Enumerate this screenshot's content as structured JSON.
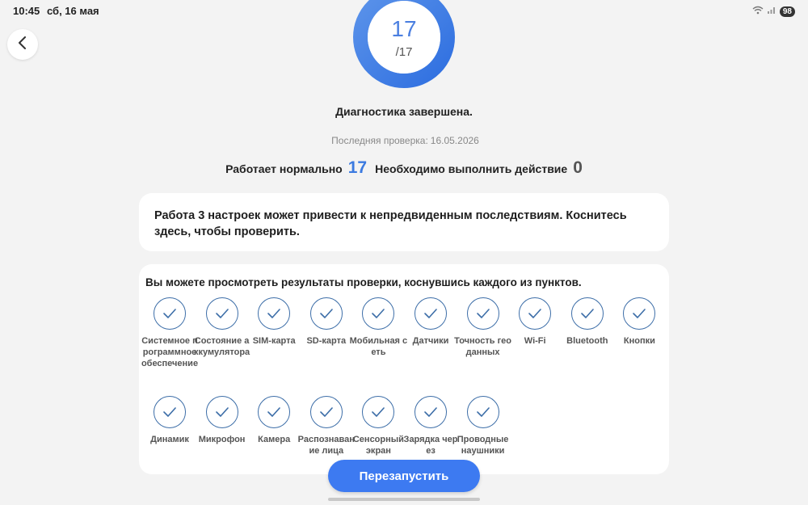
{
  "status": {
    "time": "10:45",
    "date": "сб, 16 мая",
    "battery": "98"
  },
  "score": {
    "value": "17",
    "total": "/17"
  },
  "diagnosis_title": "Диагностика завершена.",
  "last_check": {
    "label": "Последняя проверка:",
    "date": "16.05.2026"
  },
  "counts": {
    "normal_label": "Работает нормально",
    "normal_value": "17",
    "action_label": "Необходимо выполнить действие",
    "action_value": "0"
  },
  "warning_text": "Работа 3 настроек может привести к непредвиденным последствиям. Коснитесь здесь, чтобы проверить.",
  "results": {
    "title": "Вы можете просмотреть результаты проверки, коснувшись каждого из пунктов.",
    "items": [
      {
        "label": "Системное программное обеспечение"
      },
      {
        "label": "Состояние аккумулятора"
      },
      {
        "label": "SIM-карта"
      },
      {
        "label": "SD-карта"
      },
      {
        "label": "Мобильная сеть"
      },
      {
        "label": "Датчики"
      },
      {
        "label": "Точность геоданных"
      },
      {
        "label": "Wi-Fi"
      },
      {
        "label": "Bluetooth"
      },
      {
        "label": "Кнопки"
      },
      {
        "label": "Динамик"
      },
      {
        "label": "Микрофон"
      },
      {
        "label": "Камера"
      },
      {
        "label": "Распознавание лица"
      },
      {
        "label": "Сенсорный экран"
      },
      {
        "label": "Зарядка через"
      },
      {
        "label": "Проводные наушники"
      }
    ]
  },
  "restart_label": "Перезапустить",
  "colors": {
    "accent": "#3d7af1",
    "ring": "#3b7ae0",
    "check": "#3d6ea8"
  }
}
